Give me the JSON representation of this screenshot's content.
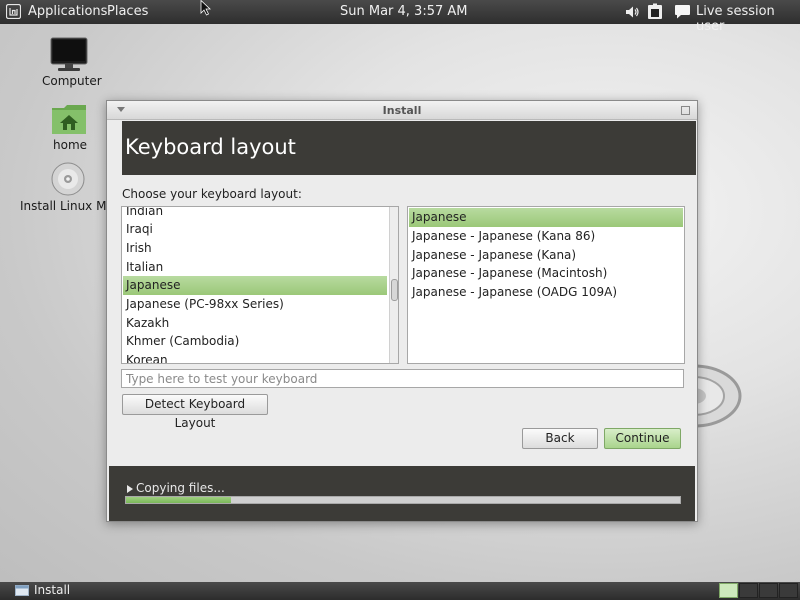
{
  "top_panel": {
    "applications": "Applications",
    "places": "Places",
    "clock": "Sun Mar  4,  3:57 AM",
    "user": "Live session user"
  },
  "desktop": {
    "icons": [
      {
        "label": "Computer",
        "icon": "computer-icon"
      },
      {
        "label": "home",
        "icon": "home-folder-icon"
      },
      {
        "label": "Install Linux Mi",
        "icon": "cd-disc-icon"
      }
    ]
  },
  "window": {
    "title": "Install",
    "header": "Keyboard layout",
    "prompt": "Choose your keyboard layout:",
    "layouts": [
      "Indian",
      "Iraqi",
      "Irish",
      "Italian",
      "Japanese",
      "Japanese (PC-98xx Series)",
      "Kazakh",
      "Khmer (Cambodia)",
      "Korean"
    ],
    "selected_layout": "Japanese",
    "variants": [
      "Japanese",
      "Japanese - Japanese (Kana 86)",
      "Japanese - Japanese (Kana)",
      "Japanese - Japanese (Macintosh)",
      "Japanese - Japanese (OADG 109A)"
    ],
    "selected_variant": "Japanese",
    "test_placeholder": "Type here to test your keyboard",
    "detect_button": "Detect Keyboard Layout",
    "back_button": "Back",
    "continue_button": "Continue",
    "progress_text": "Copying files...",
    "progress_fraction": 0.19
  },
  "bottom_panel": {
    "task_label": "Install",
    "workspaces": 4,
    "active_workspace": 1
  },
  "colors": {
    "panel": "#3a3a3a",
    "header_band": "#3c3b37",
    "selection_green": "#a8d18a",
    "progress_green": "#8ac46a"
  }
}
